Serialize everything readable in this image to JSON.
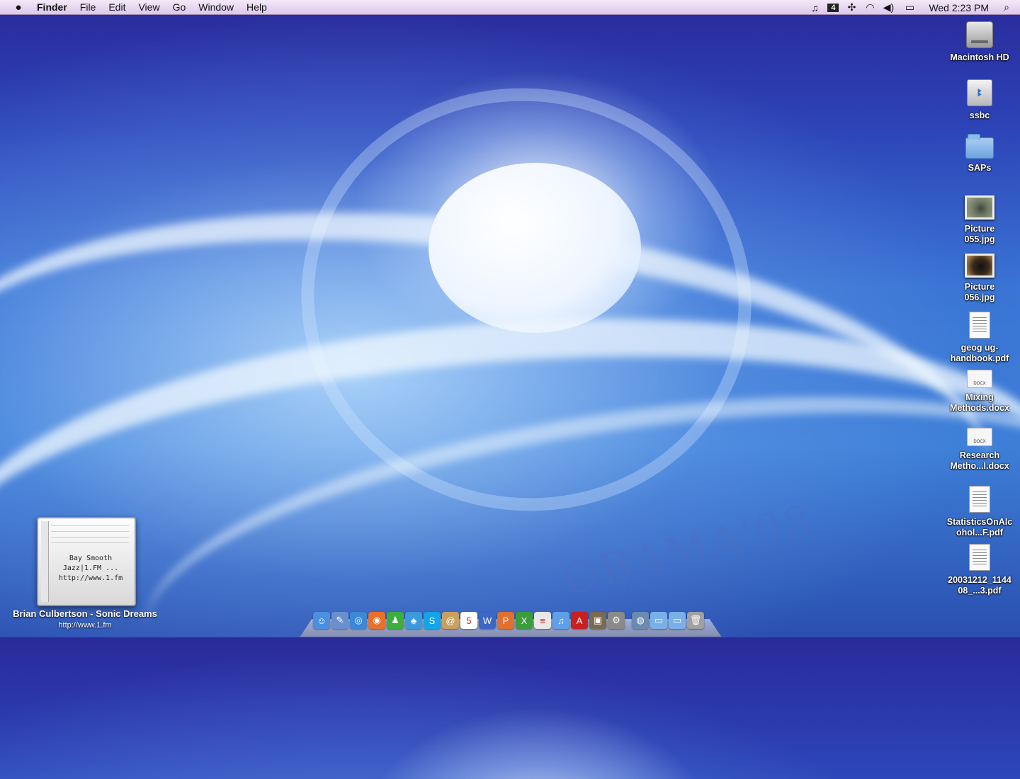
{
  "menubar": {
    "app_name": "Finder",
    "menus": [
      "File",
      "Edit",
      "View",
      "Go",
      "Window",
      "Help"
    ],
    "status_items": [
      "music-icon",
      "network-4-icon",
      "bluetooth-icon",
      "wifi-icon",
      "volume-icon",
      "battery-icon"
    ],
    "clock": "Wed 2:23 PM"
  },
  "desktop": {
    "icons": [
      {
        "label": "Macintosh HD",
        "type": "hard-drive"
      },
      {
        "label": "ssbc",
        "type": "network-volume"
      },
      {
        "label": "SAPs",
        "type": "folder"
      },
      {
        "label": "Picture 055.jpg",
        "type": "photo"
      },
      {
        "label": "Picture 056.jpg",
        "type": "photo"
      },
      {
        "label": "geog ug-handbook.pdf",
        "type": "pdf"
      },
      {
        "label": "Mixing Methods.docx",
        "type": "docx"
      },
      {
        "label": "Research Metho...l.docx",
        "type": "docx"
      },
      {
        "label": "StatisticsOnAlcohol...F.pdf",
        "type": "pdf"
      },
      {
        "label": "20031212_114408_...3.pdf",
        "type": "pdf"
      }
    ],
    "docx_badge": "DOCX",
    "wallpaper_text": "OBAMA'08",
    "wallpaper_sub": "WWW.BARACKOBAMA.COM"
  },
  "widget": {
    "station": "Bay Smooth Jazz|1.FM ...",
    "url_inner": "http://www.1.fm",
    "track": "Brian Culbertson - Sonic Dreams",
    "url": "http://www.1.fm"
  },
  "dock": {
    "items": [
      {
        "name": "finder-icon",
        "color": "#4a8fe0",
        "glyph": "☺"
      },
      {
        "name": "preview-icon",
        "color": "#6a8fcf",
        "glyph": "✎"
      },
      {
        "name": "safari-icon",
        "color": "#3b87d8",
        "glyph": "◎"
      },
      {
        "name": "firefox-icon",
        "color": "#e8702a",
        "glyph": "◉"
      },
      {
        "name": "ichat-icon",
        "color": "#3cae3c",
        "glyph": "♟"
      },
      {
        "name": "messenger-icon",
        "color": "#3b9ad9",
        "glyph": "♣"
      },
      {
        "name": "skype-icon",
        "color": "#12a5e8",
        "glyph": "S"
      },
      {
        "name": "address-book-icon",
        "color": "#c9a060",
        "glyph": "@"
      },
      {
        "name": "calendar-icon",
        "color": "#ffffff",
        "glyph": "5"
      },
      {
        "name": "word-icon",
        "color": "#3c67c4",
        "glyph": "W"
      },
      {
        "name": "powerpoint-icon",
        "color": "#e07030",
        "glyph": "P"
      },
      {
        "name": "excel-icon",
        "color": "#3c9c3c",
        "glyph": "X"
      },
      {
        "name": "textedit-icon",
        "color": "#e8e8e8",
        "glyph": "≡"
      },
      {
        "name": "itunes-icon",
        "color": "#5fa0e8",
        "glyph": "♫"
      },
      {
        "name": "acrobat-icon",
        "color": "#c82020",
        "glyph": "A"
      },
      {
        "name": "iphoto-icon",
        "color": "#7a6a50",
        "glyph": "▣"
      },
      {
        "name": "system-preferences-icon",
        "color": "#8a8a8a",
        "glyph": "⚙"
      },
      {
        "name": "network-globe-icon",
        "color": "#6a8ab0",
        "glyph": "◍"
      },
      {
        "name": "documents-folder-icon",
        "color": "#7ab0e8",
        "glyph": "▭"
      },
      {
        "name": "downloads-folder-icon",
        "color": "#7ab0e8",
        "glyph": "▭"
      },
      {
        "name": "trash-icon",
        "color": "#a0a0a0",
        "glyph": "🗑"
      }
    ]
  }
}
